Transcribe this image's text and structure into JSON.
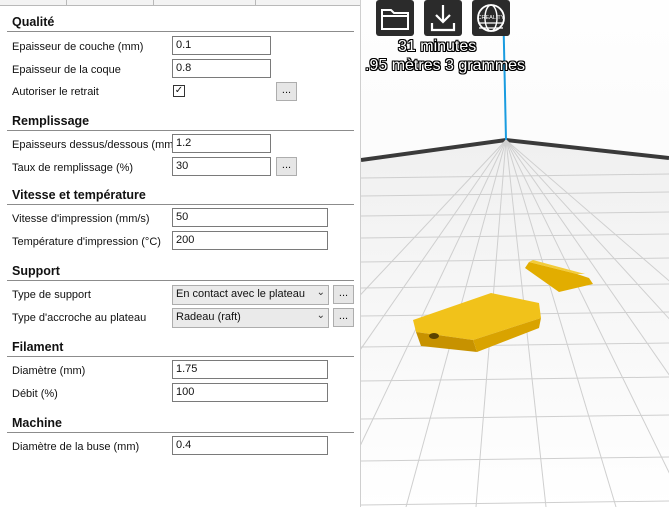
{
  "sections": {
    "quality": {
      "title": "Qualité",
      "layer_height": {
        "label": "Epaisseur de couche (mm)",
        "value": "0.1"
      },
      "shell_thickness": {
        "label": "Epaisseur de la coque",
        "value": "0.8"
      },
      "retraction": {
        "label": "Autoriser le retrait",
        "checked_glyph": "✓",
        "more": "..."
      }
    },
    "fill": {
      "title": "Remplissage",
      "top_bottom": {
        "label": "Epaisseurs dessus/dessous (mm)",
        "value": "1.2"
      },
      "density": {
        "label": "Taux de remplissage (%)",
        "value": "30",
        "more": "..."
      }
    },
    "speed": {
      "title": "Vitesse et température",
      "print_speed": {
        "label": "Vitesse d'impression (mm/s)",
        "value": "50"
      },
      "print_temp": {
        "label": "Température d'impression (°C)",
        "value": "200"
      }
    },
    "support": {
      "title": "Support",
      "type": {
        "label": "Type de support",
        "value": "En contact avec le plateau",
        "more": "..."
      },
      "adhesion": {
        "label": "Type d'accroche au plateau",
        "value": "Radeau (raft)",
        "more": "..."
      }
    },
    "filament": {
      "title": "Filament",
      "diameter": {
        "label": "Diamètre (mm)",
        "value": "1.75"
      },
      "flow": {
        "label": "Débit (%)",
        "value": "100"
      }
    },
    "machine": {
      "title": "Machine",
      "nozzle": {
        "label": "Diamètre de la buse (mm)",
        "value": "0.4"
      }
    }
  },
  "viewport": {
    "print_time": "31 minutes",
    "material": ".95 mètres 3 grammes",
    "toolbar": {
      "open_icon": "folder-icon",
      "save_icon": "download-icon",
      "brand_icon": "creality-globe-icon",
      "brand_text": "CREALITY"
    },
    "colors": {
      "model": "#e8b700",
      "z_axis": "#1a9ce0",
      "toolbar": "#2b2b2b"
    }
  }
}
